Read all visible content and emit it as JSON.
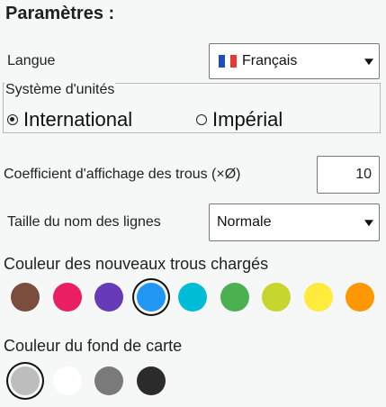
{
  "title": "Paramètres :",
  "language": {
    "label": "Langue",
    "value": "Français",
    "flag_colors": [
      "#1f4dbd",
      "#ffffff",
      "#e53935"
    ]
  },
  "units": {
    "legend": "Système d'unités",
    "options": [
      {
        "label": "International",
        "selected": true
      },
      {
        "label": "Impérial",
        "selected": false
      }
    ]
  },
  "hole_coefficient": {
    "label": "Coefficient d'affichage des trous (×Ø)",
    "value": "10"
  },
  "line_name_size": {
    "label": "Taille du nom des lignes",
    "value": "Normale"
  },
  "new_holes_color": {
    "label": "Couleur des nouveaux trous chargés",
    "colors": [
      "#7a4d3c",
      "#e91e63",
      "#673ab7",
      "#2196f3",
      "#00bcd4",
      "#4caf50",
      "#c6d62c",
      "#ffeb3b",
      "#ff9800"
    ],
    "selected_index": 3
  },
  "background_color": {
    "label": "Couleur du fond de carte",
    "colors": [
      "#bdbdbd",
      "#ffffff",
      "#7a7a7a",
      "#2b2b2b"
    ],
    "selected_index": 0
  }
}
